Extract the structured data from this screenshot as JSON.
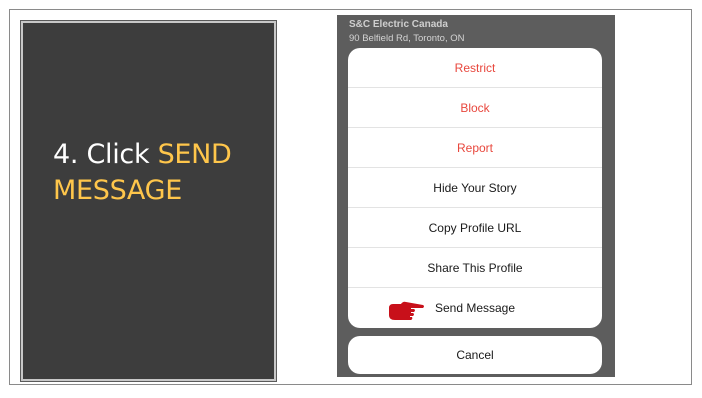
{
  "slide": {
    "step_prefix": "4. Click ",
    "step_highlight_line1": "SEND",
    "step_highlight_line2": "MESSAGE"
  },
  "phone": {
    "profile_name": "S&C Electric Canada",
    "profile_address": "90 Belfield Rd, Toronto, ON",
    "menu_items": [
      {
        "label": "Restrict",
        "style": "destructive"
      },
      {
        "label": "Block",
        "style": "destructive"
      },
      {
        "label": "Report",
        "style": "destructive"
      },
      {
        "label": "Hide Your Story",
        "style": "default"
      },
      {
        "label": "Copy Profile URL",
        "style": "default"
      },
      {
        "label": "Share This Profile",
        "style": "default"
      },
      {
        "label": "Send Message",
        "style": "default"
      }
    ],
    "cancel_label": "Cancel",
    "pointer_icon": "pointing-hand-icon"
  },
  "colors": {
    "panel_bg": "#3d3d3d",
    "highlight": "#ffc64b",
    "destructive": "#e8473d",
    "pointer": "#c8101a"
  }
}
